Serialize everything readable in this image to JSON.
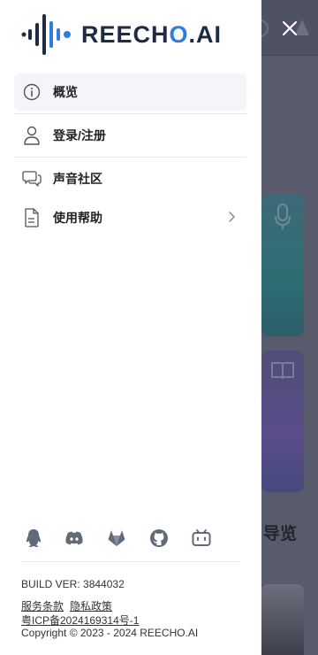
{
  "brand": {
    "logo_text_1": "reech",
    "logo_text_2": "o",
    "logo_text_3": ".AI"
  },
  "menu": {
    "items": [
      {
        "label": "概览",
        "icon": "info-icon"
      },
      {
        "label": "登录/注册",
        "icon": "user-icon"
      },
      {
        "label": "声音社区",
        "icon": "chat-icon"
      },
      {
        "label": "使用帮助",
        "icon": "document-icon"
      }
    ]
  },
  "socials": [
    "qq-icon",
    "discord-icon",
    "gitlab-icon",
    "github-icon",
    "bilibili-icon"
  ],
  "footer": {
    "build": "BUILD VER: 3844032",
    "terms": "服务条款",
    "privacy": "隐私政策",
    "icp": "粤ICP备2024169314号-1",
    "copyright": "Copyright © 2023 - 2024 REECHO.AI"
  },
  "background": {
    "section_title": "导览"
  },
  "colors": {
    "accent": "#2f7de1",
    "brand_dark": "#1f2a44",
    "overlay": "#585b6b"
  }
}
